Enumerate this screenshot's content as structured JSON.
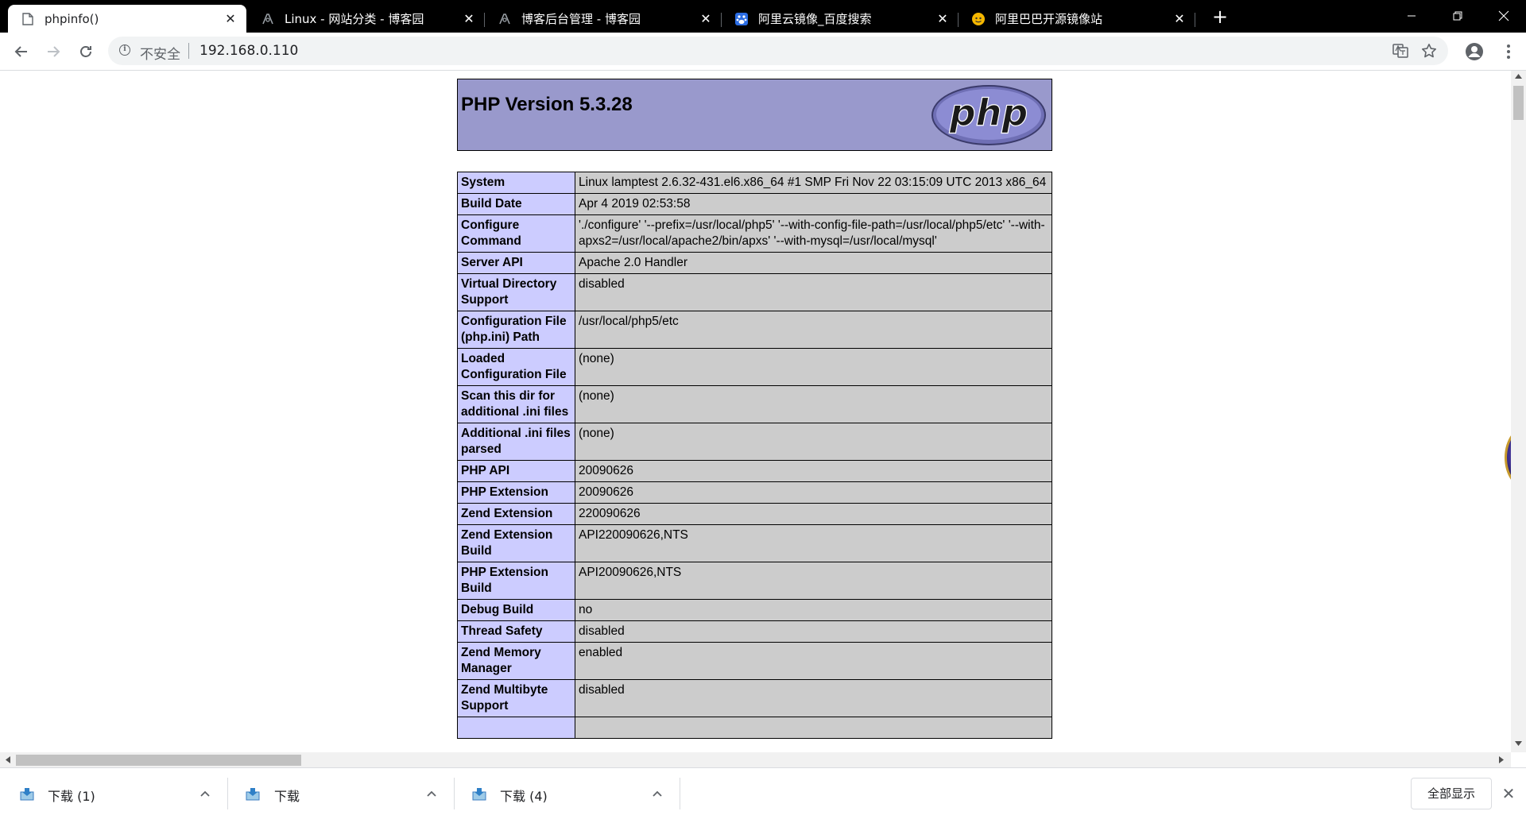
{
  "browser": {
    "tabs": [
      {
        "title": "phpinfo()",
        "active": true,
        "favicon": "document-icon"
      },
      {
        "title": "Linux - 网站分类 - 博客园",
        "active": false,
        "favicon": "cnblogs-icon"
      },
      {
        "title": "博客后台管理 - 博客园",
        "active": false,
        "favicon": "cnblogs-icon"
      },
      {
        "title": "阿里云镜像_百度搜索",
        "active": false,
        "favicon": "baidu-icon"
      },
      {
        "title": "阿里巴巴开源镜像站",
        "active": false,
        "favicon": "aliyun-icon"
      }
    ],
    "tab_close": "✕",
    "new_tab": "+",
    "address": {
      "security_label": "不安全",
      "url": "192.168.0.110"
    }
  },
  "page": {
    "header_title": "PHP Version 5.3.28",
    "logo_text": "php",
    "rows": [
      {
        "key": "System",
        "value": "Linux lamptest 2.6.32-431.el6.x86_64 #1 SMP Fri Nov 22 03:15:09 UTC 2013 x86_64"
      },
      {
        "key": "Build Date",
        "value": "Apr 4 2019 02:53:58"
      },
      {
        "key": "Configure Command",
        "value": "'./configure' '--prefix=/usr/local/php5' '--with-config-file-path=/usr/local/php5/etc' '--with-apxs2=/usr/local/apache2/bin/apxs' '--with-mysql=/usr/local/mysql'"
      },
      {
        "key": "Server API",
        "value": "Apache 2.0 Handler"
      },
      {
        "key": "Virtual Directory Support",
        "value": "disabled"
      },
      {
        "key": "Configuration File (php.ini) Path",
        "value": "/usr/local/php5/etc"
      },
      {
        "key": "Loaded Configuration File",
        "value": "(none)"
      },
      {
        "key": "Scan this dir for additional .ini files",
        "value": "(none)"
      },
      {
        "key": "Additional .ini files parsed",
        "value": "(none)"
      },
      {
        "key": "PHP API",
        "value": "20090626"
      },
      {
        "key": "PHP Extension",
        "value": "20090626"
      },
      {
        "key": "Zend Extension",
        "value": "220090626"
      },
      {
        "key": "Zend Extension Build",
        "value": "API220090626,NTS"
      },
      {
        "key": "PHP Extension Build",
        "value": "API20090626,NTS"
      },
      {
        "key": "Debug Build",
        "value": "no"
      },
      {
        "key": "Thread Safety",
        "value": "disabled"
      },
      {
        "key": "Zend Memory Manager",
        "value": "enabled"
      },
      {
        "key": "Zend Multibyte Support",
        "value": "disabled"
      },
      {
        "key": "",
        "value": ""
      }
    ]
  },
  "downloads": {
    "items": [
      {
        "name": "下载 (1)"
      },
      {
        "name": "下载"
      },
      {
        "name": "下载 (4)"
      }
    ],
    "show_all": "全部显示",
    "close": "✕"
  }
}
